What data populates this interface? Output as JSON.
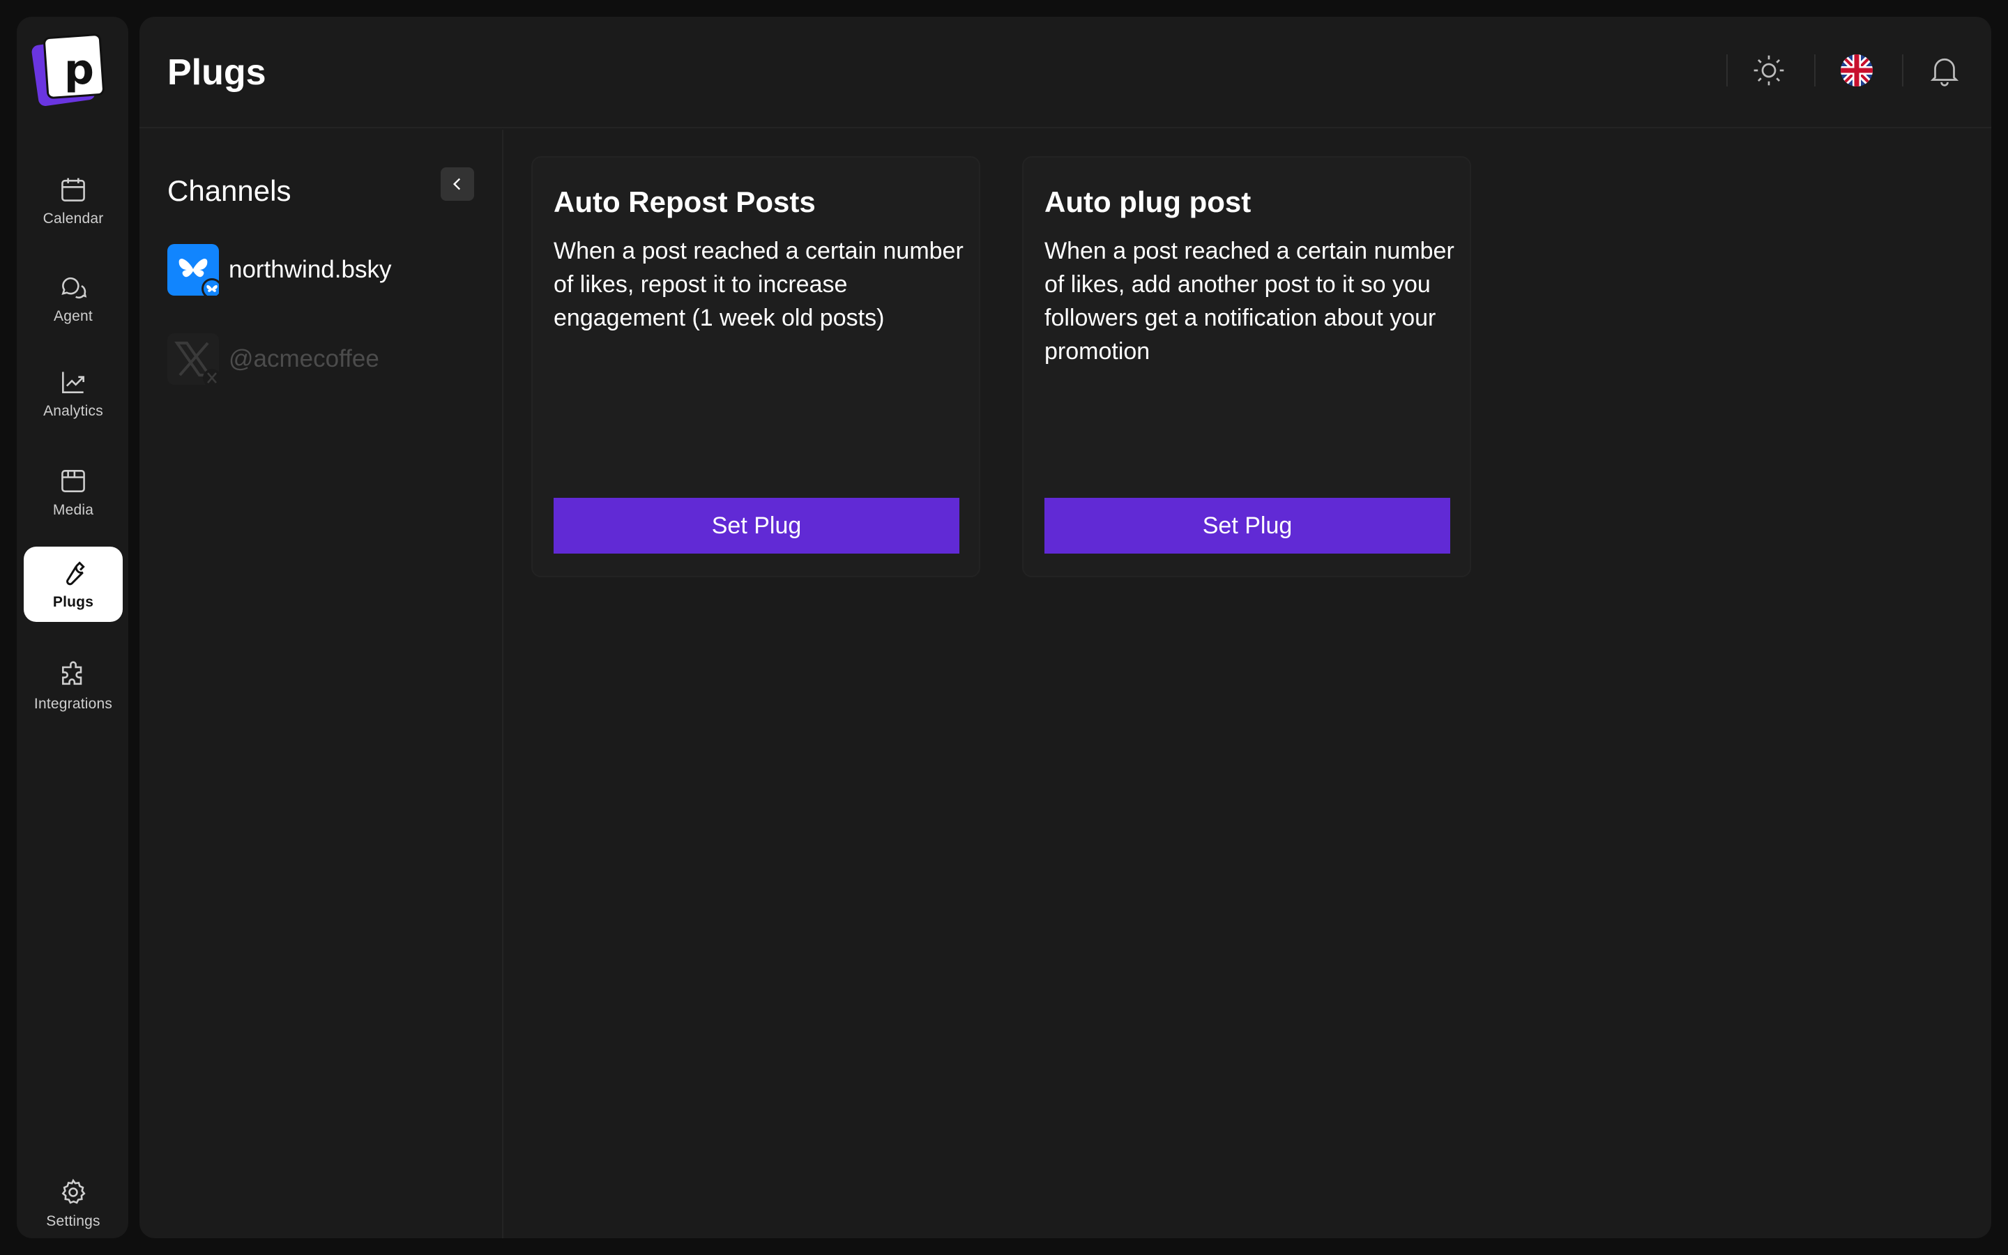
{
  "app": {
    "page_title": "Plugs",
    "logo_letter": "p"
  },
  "nav": {
    "items": [
      {
        "label": "Calendar",
        "icon": "calendar-icon"
      },
      {
        "label": "Agent",
        "icon": "chat-bubbles-icon"
      },
      {
        "label": "Analytics",
        "icon": "trend-chart-icon"
      },
      {
        "label": "Media",
        "icon": "media-window-icon"
      },
      {
        "label": "Plugs",
        "icon": "wrench-icon",
        "active": true
      },
      {
        "label": "Integrations",
        "icon": "puzzle-icon"
      }
    ],
    "settings_label": "Settings"
  },
  "topbar": {
    "icons": [
      "sun-icon",
      "uk-flag-icon",
      "bell-icon"
    ]
  },
  "channels": {
    "title": "Channels",
    "items": [
      {
        "name": "northwind.bsky",
        "platform": "bluesky",
        "enabled": true
      },
      {
        "name": "@acmecoffee",
        "platform": "x",
        "enabled": false
      }
    ]
  },
  "plugs": [
    {
      "title": "Auto Repost Posts",
      "description": "When a post reached a certain number of likes, repost it to increase engagement (1 week old posts)",
      "button": "Set Plug"
    },
    {
      "title": "Auto plug post",
      "description": "When a post reached a certain number of likes, add another post to it so you followers get a notification about your promotion",
      "button": "Set Plug"
    }
  ],
  "colors": {
    "accent": "#612ad5",
    "logo_purple": "#6a35e0",
    "bluesky_blue": "#1185fe",
    "panel_bg": "#1b1b1b",
    "rail_bg": "#1a1a1a"
  }
}
